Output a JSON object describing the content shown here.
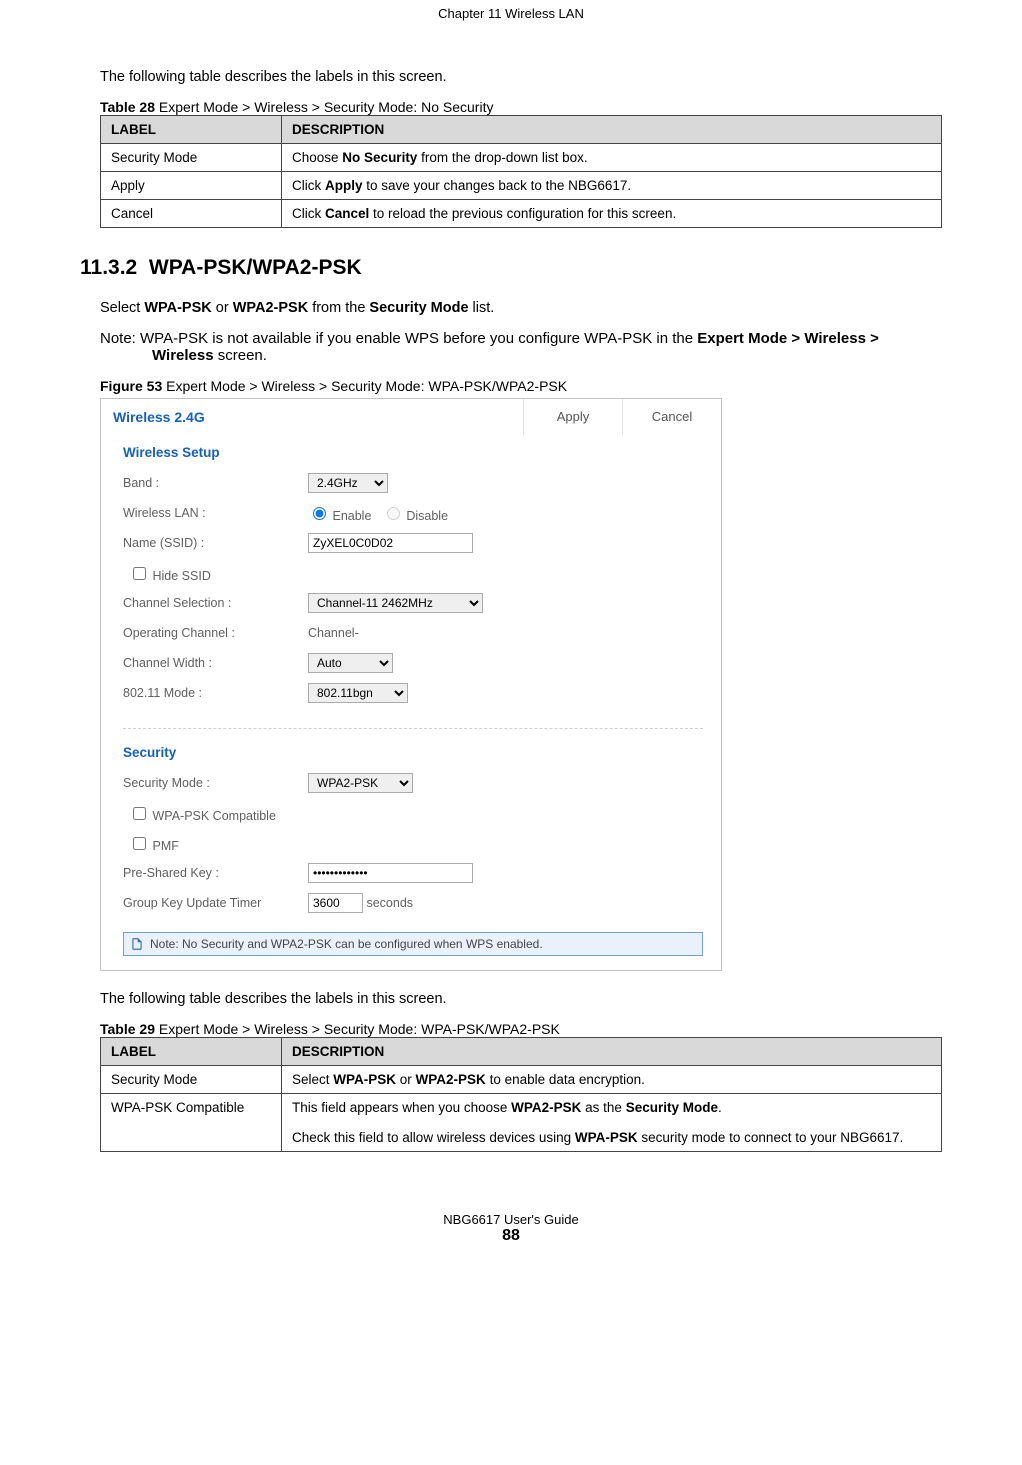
{
  "chapter": "Chapter 11 Wireless LAN",
  "intro1": "The following table describes the labels in this screen.",
  "table28": {
    "caption_bold": "Table 28",
    "caption_rest": "   Expert Mode > Wireless > Security Mode: No Security",
    "head_label": "LABEL",
    "head_desc": "DESCRIPTION",
    "rows": [
      {
        "label": "Security Mode",
        "desc_pre": "Choose ",
        "desc_b": "No Security",
        "desc_post": " from the drop-down list box."
      },
      {
        "label": "Apply",
        "desc_pre": "Click ",
        "desc_b": "Apply",
        "desc_post": " to save your changes back to the NBG6617."
      },
      {
        "label": "Cancel",
        "desc_pre": "Click ",
        "desc_b": "Cancel",
        "desc_post": " to reload the previous configuration for this screen."
      }
    ]
  },
  "section_num": "11.3.2",
  "section_title": "WPA-PSK/WPA2-PSK",
  "section_p1_pre": "Select ",
  "section_p1_b1": "WPA-PSK",
  "section_p1_mid1": " or ",
  "section_p1_b2": "WPA2-PSK",
  "section_p1_mid2": " from the ",
  "section_p1_b3": "Security Mode",
  "section_p1_post": " list.",
  "note_pre": "Note: WPA-PSK is not available if you enable WPS before you configure WPA-PSK in the ",
  "note_b1": "Expert Mode > Wireless > Wireless",
  "note_post": " screen.",
  "figure_caption_bold": "Figure 53",
  "figure_caption_rest": "   Expert Mode > Wireless > Security Mode: WPA-PSK/WPA2-PSK",
  "fig": {
    "title": "Wireless 2.4G",
    "apply": "Apply",
    "cancel": "Cancel",
    "sec1": "Wireless Setup",
    "band_l": "Band :",
    "band_v": "2.4GHz",
    "wlan_l": "Wireless LAN :",
    "enable": "Enable",
    "disable": "Disable",
    "ssid_l": "Name (SSID) :",
    "ssid_v": "ZyXEL0C0D02",
    "hide_l": "Hide SSID",
    "chsel_l": "Channel Selection :",
    "chsel_v": "Channel-11 2462MHz",
    "opch_l": "Operating Channel :",
    "opch_v": "Channel-",
    "chw_l": "Channel Width :",
    "chw_v": "Auto",
    "mode_l": "802.11 Mode :",
    "mode_v": "802.11bgn",
    "sec2": "Security",
    "secmode_l": "Security Mode :",
    "secmode_v": "WPA2-PSK",
    "wpacomp_l": "WPA-PSK Compatible",
    "pmf_l": "PMF",
    "psk_l": "Pre-Shared Key :",
    "psk_v": "•••••••••••••",
    "gkt_l": "Group Key Update Timer",
    "gkt_v": "3600",
    "gkt_unit": "seconds",
    "note": "Note: No Security and WPA2-PSK can be configured when WPS enabled."
  },
  "intro2": "The following table describes the labels in this screen.",
  "table29": {
    "caption_bold": "Table 29",
    "caption_rest": "   Expert Mode > Wireless > Security Mode: WPA-PSK/WPA2-PSK",
    "head_label": "LABEL",
    "head_desc": "DESCRIPTION",
    "r1_label": "Security Mode",
    "r1_pre": "Select ",
    "r1_b1": "WPA-PSK",
    "r1_mid": " or ",
    "r1_b2": "WPA2-PSK",
    "r1_post": " to enable data encryption.",
    "r2_label": "WPA-PSK Compatible",
    "r2_l1_pre": "This field appears when you choose ",
    "r2_l1_b1": "WPA2-PSK",
    "r2_l1_mid": " as the ",
    "r2_l1_b2": "Security Mode",
    "r2_l1_post": ".",
    "r2_l2_pre": "Check this field to allow wireless devices using ",
    "r2_l2_b1": "WPA-PSK",
    "r2_l2_post": " security mode to connect to your NBG6617."
  },
  "footer": "NBG6617 User's Guide",
  "page_number": "88"
}
